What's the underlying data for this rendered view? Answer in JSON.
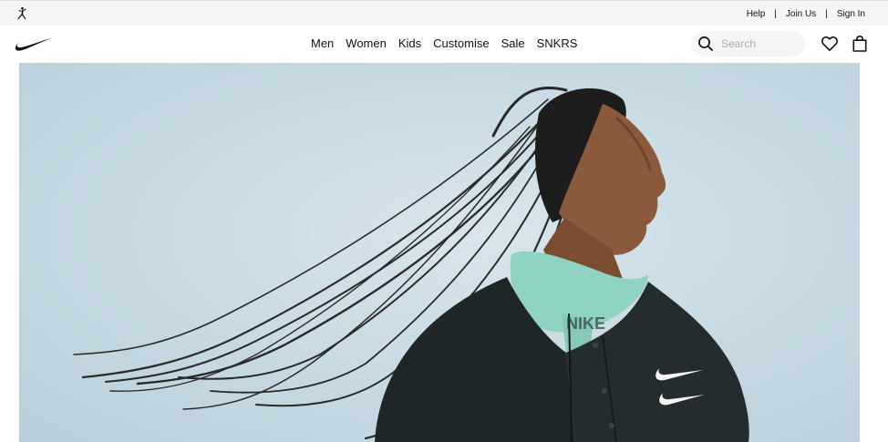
{
  "top_bar": {
    "brand_icon": "jordan-jumpman-icon",
    "links": [
      {
        "label": "Help"
      },
      {
        "label": "Join Us"
      },
      {
        "label": "Sign In"
      }
    ],
    "separator": "|"
  },
  "nav": {
    "brand_icon": "nike-swoosh-icon",
    "menu": [
      {
        "label": "Men"
      },
      {
        "label": "Women"
      },
      {
        "label": "Kids"
      },
      {
        "label": "Customise"
      },
      {
        "label": "Sale"
      },
      {
        "label": "SNKRS"
      }
    ],
    "search": {
      "placeholder": "Search",
      "value": ""
    },
    "icons": {
      "search": "search-icon",
      "favorites": "heart-icon",
      "cart": "bag-icon"
    }
  },
  "hero": {
    "alt": "Athlete with long braids in a black jacket against a pale blue sky",
    "jacket_print": "NIKE"
  },
  "colors": {
    "text": "#111111",
    "top_bar_bg": "#f5f5f5",
    "search_bg": "#f5f5f5",
    "sky": "#c6d9e3",
    "jacket": "#1f2628",
    "hoodie": "#8fd3c2"
  }
}
